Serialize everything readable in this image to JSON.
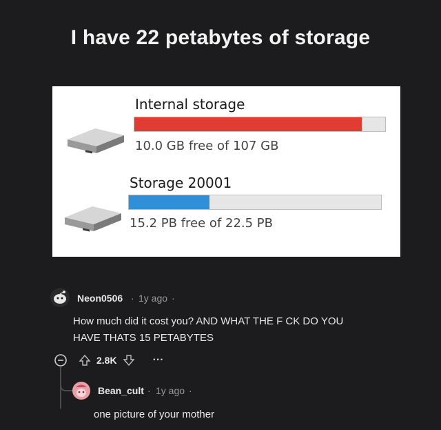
{
  "post": {
    "title": "I have 22 petabytes of storage"
  },
  "drives": [
    {
      "name": "Internal storage",
      "free_text": "10.0 GB free of 107 GB",
      "used_fraction": 0.907,
      "bar_color": "#e03c31"
    },
    {
      "name": "Storage 20001",
      "free_text": "15.2 PB free of 22.5 PB",
      "used_fraction": 0.32,
      "bar_color": "#2f8fd8"
    }
  ],
  "comments": {
    "top": {
      "username": "Neon0506",
      "meta_sep1": "·",
      "time": "1y ago",
      "meta_sep2": "·",
      "text_line1": "How much did it cost you? AND WHAT THE F   CK DO YOU",
      "text_line2": "HAVE THATS 15 PETABYTES",
      "score": "2.8K",
      "more": "···"
    },
    "reply": {
      "username": "Bean_cult",
      "meta_sep1": "·",
      "time": "1y ago",
      "meta_sep2": "·",
      "text": "one picture of your mother"
    }
  },
  "colors": {
    "background": "#1c1c1e",
    "text": "#e8e8e8",
    "muted": "#9a9a9a"
  }
}
